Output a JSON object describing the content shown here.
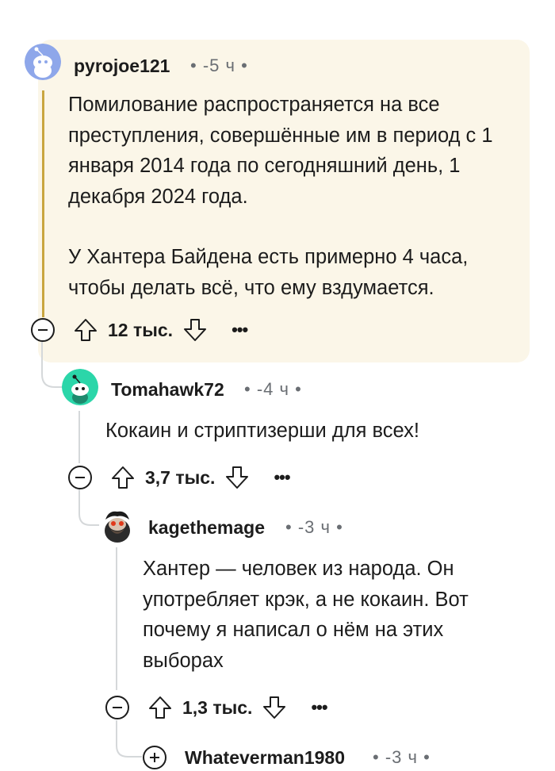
{
  "comments": [
    {
      "username": "pyrojoe121",
      "time": "• -5 ч •",
      "paragraphs": [
        "Помилование распространяется на все преступления, совершённые им в период с 1 января 2014 года по сегодняшний день, 1 декабря 2024 года.",
        "У Хантера Байдена есть примерно 4 часа, чтобы делать всё, что ему вздумается."
      ],
      "votes": "12 тыс.",
      "avatar_color": "#8ea7ea"
    },
    {
      "username": "Tomahawk72",
      "time": "• -4 ч •",
      "paragraphs": [
        "Кокаин и стриптизерши для всех!"
      ],
      "votes": "3,7 тыс.",
      "avatar_color": "#2bd6a9"
    },
    {
      "username": "kagethemage",
      "time": "• -3 ч •",
      "paragraphs": [
        "Хантер — человек из народа. Он употребляет крэк, а не кокаин. Вот почему я написал о нём на этих выборах"
      ],
      "votes": "1,3 тыс.",
      "avatar_color": "#2b2b2b"
    },
    {
      "username": "Whateverman1980",
      "time": "• -3 ч •"
    }
  ],
  "icons": {
    "collapse": "minus-circle-icon",
    "expand": "plus-circle-icon",
    "upvote": "arrow-up-icon",
    "downvote": "arrow-down-icon",
    "more": "more-horizontal-icon"
  },
  "more_label": "•••",
  "colors": {
    "highlight_bg": "#fbf6e8",
    "accent_line": "#c9a640",
    "thread_line": "#d5d8da",
    "meta_text": "#6a6e73"
  }
}
